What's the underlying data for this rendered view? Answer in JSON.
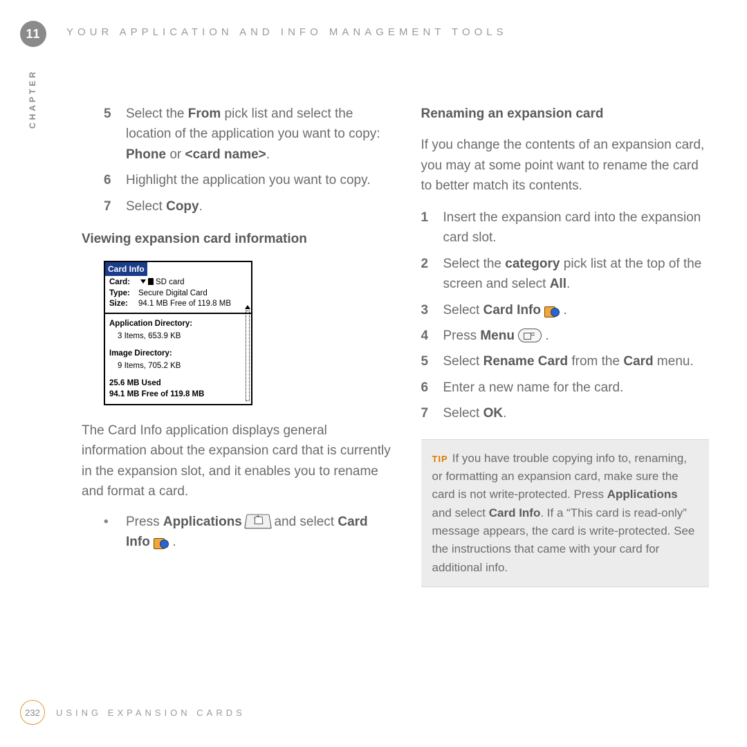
{
  "chapter": {
    "number": "11",
    "label": "CHAPTER"
  },
  "header": {
    "title": "YOUR APPLICATION AND INFO MANAGEMENT TOOLS"
  },
  "left": {
    "steps_a": [
      {
        "n": "5",
        "pre": "Select the ",
        "b1": "From",
        "mid": " pick list and select the location of the application you want to copy: ",
        "b2": "Phone",
        "mid2": " or ",
        "b3": "<card name>",
        "post": "."
      },
      {
        "n": "6",
        "text": "Highlight the application you want to copy."
      },
      {
        "n": "7",
        "pre": "Select ",
        "b1": "Copy",
        "post": "."
      }
    ],
    "subhead": "Viewing expansion card information",
    "card": {
      "title": "Card Info",
      "card_label": "Card:",
      "card_value": "SD card",
      "type_label": "Type:",
      "type_value": "Secure Digital Card",
      "size_label": "Size:",
      "size_value": "94.1 MB Free of 119.8 MB",
      "app_dir_label": "Application Directory:",
      "app_dir_value": "3 Items, 653.9 KB",
      "img_dir_label": "Image Directory:",
      "img_dir_value": "9 Items, 705.2 KB",
      "used": "25.6 MB Used",
      "free": "94.1 MB Free of 119.8 MB"
    },
    "para": "The Card Info application displays general information about the expansion card that is currently in the expansion slot, and it enables you to rename and format a card.",
    "bullet": {
      "pre": "Press ",
      "b1": "Applications",
      "mid": " and select ",
      "b2": "Card Info",
      "post": " ."
    }
  },
  "right": {
    "heading": "Renaming an expansion card",
    "intro": "If you change the contents of an expansion card, you may at some point want to rename the card to better match its contents.",
    "steps": [
      {
        "n": "1",
        "text": "Insert the expansion card into the expansion card slot."
      },
      {
        "n": "2",
        "pre": "Select the ",
        "b1": "category",
        "mid": " pick list at the top of the screen and select ",
        "b2": "All",
        "post": "."
      },
      {
        "n": "3",
        "pre": "Select ",
        "b1": "Card Info",
        "post": " ."
      },
      {
        "n": "4",
        "pre": "Press ",
        "b1": "Menu",
        "post": " ."
      },
      {
        "n": "5",
        "pre": "Select ",
        "b1": "Rename Card",
        "mid": " from the ",
        "b2": "Card",
        "post": " menu."
      },
      {
        "n": "6",
        "text": "Enter a new name for the card."
      },
      {
        "n": "7",
        "pre": "Select ",
        "b1": "OK",
        "post": "."
      }
    ],
    "tip": {
      "label": "TIP",
      "t1": "If you have trouble copying info to, renaming, or formatting an expansion card, make sure the card is not write-protected. Press ",
      "b1": "Applications",
      "t2": " and select ",
      "b2": "Card Info",
      "t3": ". If a “This card is read-only” message appears, the card is write-protected. See the instructions that came with your card for additional info."
    }
  },
  "footer": {
    "page": "232",
    "title": "USING EXPANSION CARDS"
  }
}
